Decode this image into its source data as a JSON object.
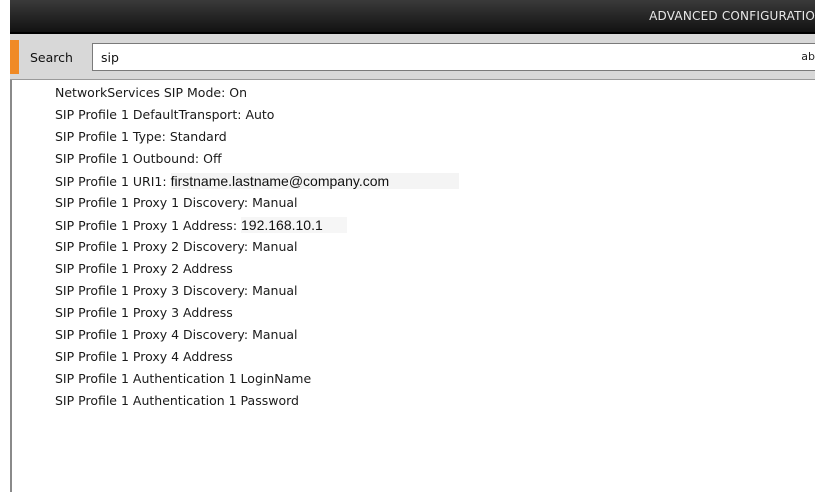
{
  "header": {
    "title": "ADVANCED CONFIGURATIO"
  },
  "search": {
    "label": "Search",
    "value": "sip",
    "keyboard_hint": "ab"
  },
  "settings": [
    {
      "label": "NetworkServices SIP Mode:",
      "value": "On"
    },
    {
      "label": "SIP Profile 1 DefaultTransport:",
      "value": "Auto"
    },
    {
      "label": "SIP Profile 1 Type:",
      "value": "Standard"
    },
    {
      "label": "SIP Profile 1 Outbound:",
      "value": "Off"
    },
    {
      "label": "SIP Profile 1 URI1:",
      "value": "firstname.lastname@company.com"
    },
    {
      "label": "SIP Profile 1 Proxy 1 Discovery:",
      "value": "Manual"
    },
    {
      "label": "SIP Profile 1 Proxy 1 Address:",
      "value": "192.168.10.1"
    },
    {
      "label": "SIP Profile 1 Proxy 2 Discovery:",
      "value": "Manual"
    },
    {
      "label": "SIP Profile 1 Proxy 2 Address",
      "value": ""
    },
    {
      "label": "SIP Profile 1 Proxy 3 Discovery:",
      "value": "Manual"
    },
    {
      "label": "SIP Profile 1 Proxy 3 Address",
      "value": ""
    },
    {
      "label": "SIP Profile 1 Proxy 4 Discovery:",
      "value": "Manual"
    },
    {
      "label": "SIP Profile 1 Proxy 4 Address",
      "value": ""
    },
    {
      "label": "SIP Profile 1 Authentication 1 LoginName",
      "value": ""
    },
    {
      "label": "SIP Profile 1 Authentication 1 Password",
      "value": ""
    }
  ],
  "colors": {
    "accent": "#f08a25",
    "titlebar": "#1e1e1e"
  }
}
